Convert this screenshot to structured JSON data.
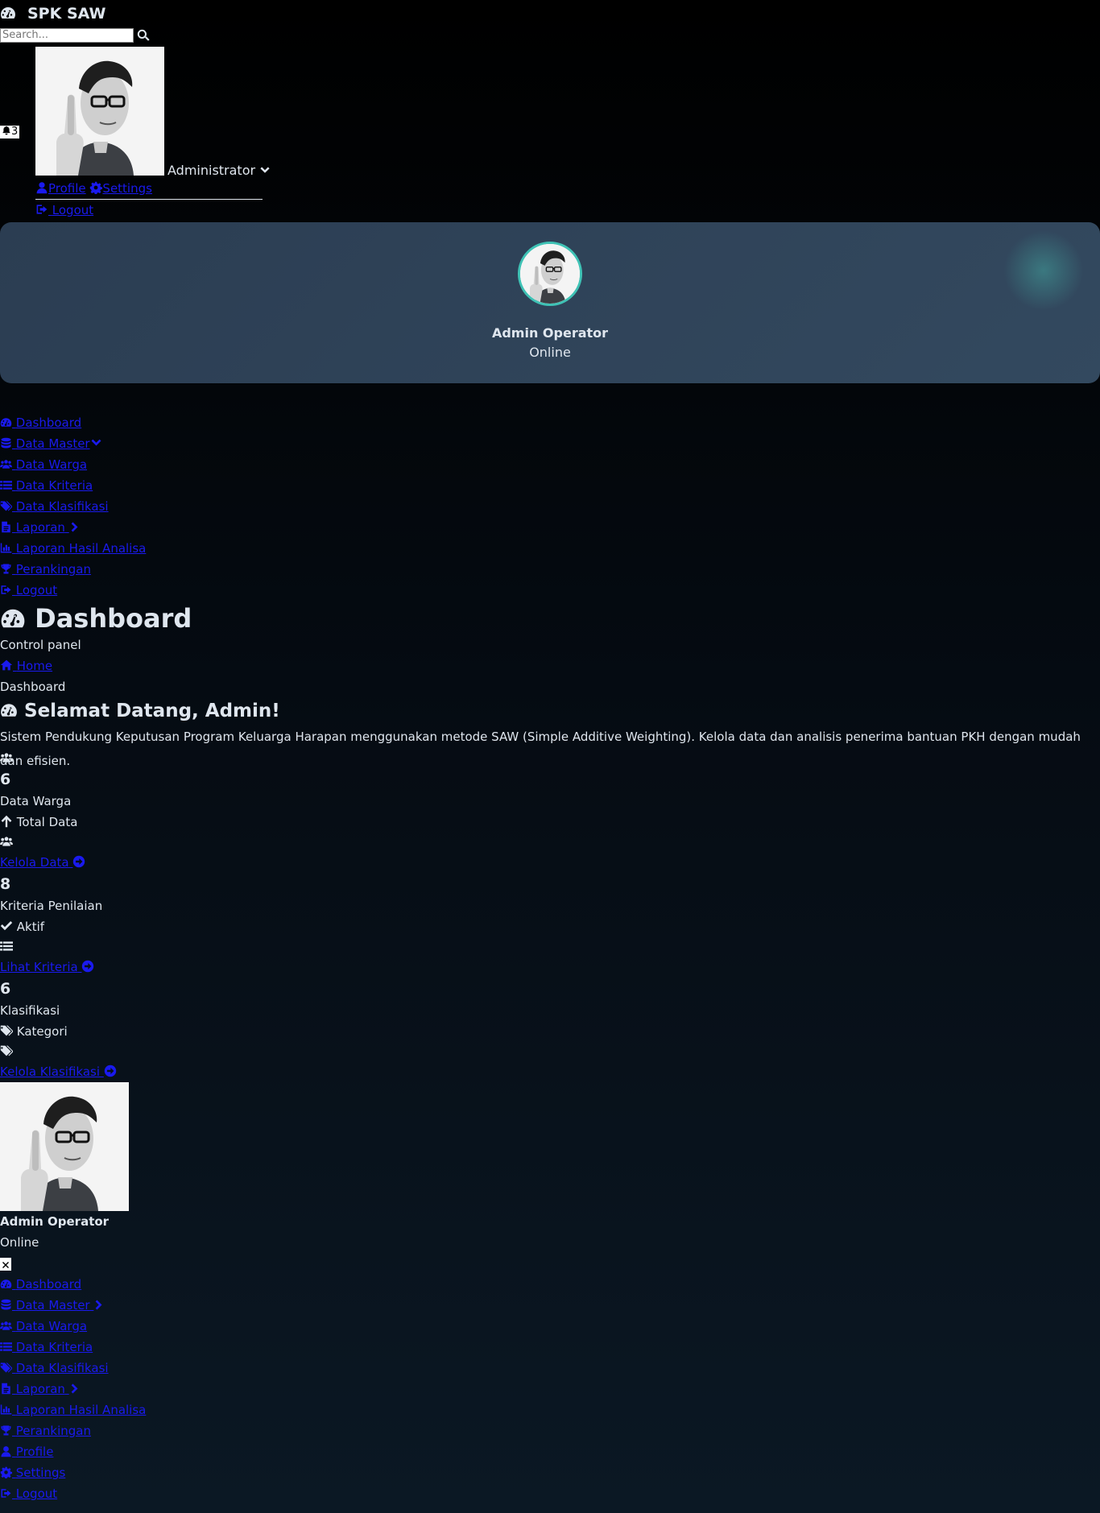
{
  "header": {
    "brand": "SPK SAW",
    "search_placeholder": "Search...",
    "notif_count": "3",
    "user_name": "Administrator",
    "menu": {
      "profile": "Profile",
      "settings": "Settings",
      "logout": "Logout"
    }
  },
  "profile_card": {
    "name": "Admin Operator",
    "status": "Online"
  },
  "sidebar": {
    "items": [
      {
        "label": "Dashboard",
        "icon": "dashboard-icon"
      },
      {
        "label": "Data Master",
        "icon": "database-icon",
        "chevron": "chevron-down-icon"
      },
      {
        "label": "Data Warga",
        "icon": "users-icon"
      },
      {
        "label": "Data Kriteria",
        "icon": "list-icon"
      },
      {
        "label": "Data Klasifikasi",
        "icon": "tags-icon"
      },
      {
        "label": "Laporan",
        "icon": "file-icon",
        "chevron": "chevron-right-icon"
      },
      {
        "label": "Laporan Hasil Analisa",
        "icon": "chart-icon"
      },
      {
        "label": "Perankingan",
        "icon": "trophy-icon"
      },
      {
        "label": "Logout",
        "icon": "logout-icon"
      }
    ]
  },
  "content": {
    "title": "Dashboard",
    "subtitle": "Control panel",
    "breadcrumb_home": "Home",
    "breadcrumb_current": "Dashboard",
    "welcome_title": "Selamat Datang, Admin!",
    "welcome_text": "Sistem Pendukung Keputusan Program Keluarga Harapan menggunakan metode SAW (Simple Additive Weighting). Kelola data dan analisis penerima bantuan PKH dengan mudah dan efisien.",
    "stats": [
      {
        "value": "6",
        "label": "Data Warga",
        "note": "Total Data",
        "note_icon": "arrow-up-icon",
        "link": "Kelola Data"
      },
      {
        "value": "8",
        "label": "Kriteria Penilaian",
        "note": "Aktif",
        "note_icon": "check-icon",
        "link": "Lihat Kriteria"
      },
      {
        "value": "6",
        "label": "Klasifikasi",
        "note": "Kategori",
        "note_icon": "tags-icon",
        "link": "Kelola Klasifikasi"
      }
    ]
  },
  "mobile_sidebar": {
    "name": "Admin Operator",
    "status": "Online",
    "items": [
      {
        "label": "Dashboard"
      },
      {
        "label": "Data Master"
      },
      {
        "label": "Data Warga"
      },
      {
        "label": "Data Kriteria"
      },
      {
        "label": "Data Klasifikasi"
      },
      {
        "label": "Laporan"
      },
      {
        "label": "Laporan Hasil Analisa"
      },
      {
        "label": "Perankingan"
      },
      {
        "label": "Profile"
      },
      {
        "label": "Settings"
      },
      {
        "label": "Logout"
      }
    ]
  }
}
